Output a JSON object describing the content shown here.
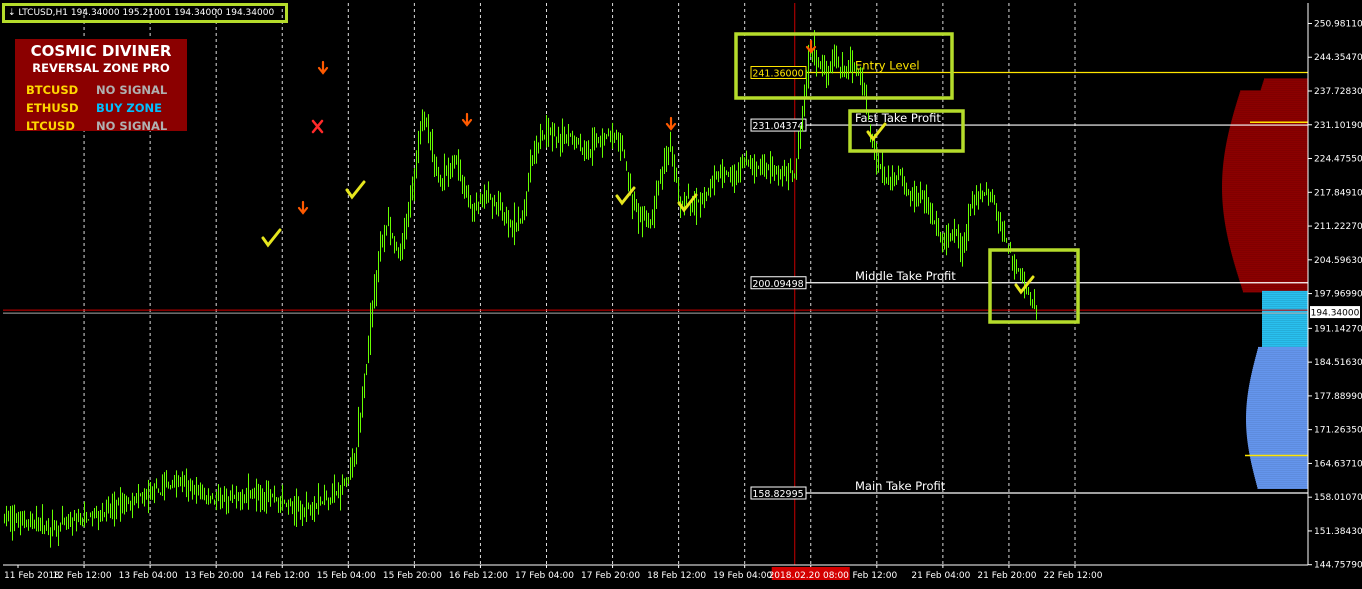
{
  "header": {
    "symbol_text": "LTCUSD,H1",
    "ohlc_text": "194.34000 195.21001 194.34000 194.34000"
  },
  "panel": {
    "title": "COSMIC DIVINER",
    "subtitle": "REVERSAL ZONE PRO",
    "rows": [
      {
        "symbol": "BTCUSD",
        "status": "NO SIGNAL",
        "color": "#b0b0b0"
      },
      {
        "symbol": "ETHUSD",
        "status": "BUY ZONE",
        "color": "#00bfff"
      },
      {
        "symbol": "LTCUSD",
        "status": "NO SIGNAL",
        "color": "#b0b0b0"
      }
    ]
  },
  "colors": {
    "candle": "#66ff00",
    "frame": "#b5dc2b",
    "check": "#e6e61e",
    "arrow": "#ff5a00",
    "cross": "#ff2a2a",
    "sell_zone": "#8b0000",
    "mid_zone": "#29c0ef",
    "buy_zone": "#6495ed",
    "yellow_line": "#ffe500"
  },
  "chart_data": {
    "type": "candlestick",
    "ylim": [
      144.7,
      255.0
    ],
    "y_ticks": [
      "250.98110",
      "244.35470",
      "237.72830",
      "231.10190",
      "224.47550",
      "217.84910",
      "211.22270",
      "204.59630",
      "197.96990",
      "191.14270",
      "184.51630",
      "177.88990",
      "171.26350",
      "164.63710",
      "158.01070",
      "151.38430",
      "144.75790"
    ],
    "y_tick_values": [
      250.9811,
      244.3547,
      237.7283,
      231.1019,
      224.4755,
      217.8491,
      211.2227,
      204.5963,
      197.9699,
      191.1427,
      184.5163,
      177.8899,
      171.2635,
      164.6371,
      158.0107,
      151.3843,
      144.7579
    ],
    "x_ticks": [
      "11 Feb 2018",
      "12 Feb 12:00",
      "13 Feb 04:00",
      "13 Feb 20:00",
      "14 Feb 12:00",
      "15 Feb 04:00",
      "15 Feb 20:00",
      "16 Feb 12:00",
      "17 Feb 04:00",
      "17 Feb 20:00",
      "18 Feb 12:00",
      "19 Feb 04:00",
      "2018.02.20 08:00",
      "Feb 12:00",
      "21 Feb 04:00",
      "21 Feb 20:00",
      "22 Feb 12:00"
    ],
    "current_price": "194.34000",
    "current_price_value": 194.34,
    "current_time_label": "2018.02.20 08:00",
    "levels": [
      {
        "name": "Entry Level",
        "value": 241.36,
        "label": "241.36000",
        "color": "#ffe500"
      },
      {
        "name": "Fast Take Profit",
        "value": 231.04374,
        "label": "231.04374",
        "color": "#ffffff"
      },
      {
        "name": "Middle Take Profit",
        "value": 200.09498,
        "label": "200.09498",
        "color": "#ffffff"
      },
      {
        "name": "Main Take Profit",
        "value": 158.82995,
        "label": "158.82995",
        "color": "#ffffff"
      }
    ],
    "price_path": [
      [
        0,
        154
      ],
      [
        2,
        152
      ],
      [
        4,
        155
      ],
      [
        5,
        157
      ],
      [
        6,
        159
      ],
      [
        7,
        161
      ],
      [
        8,
        158.5
      ],
      [
        9,
        157
      ],
      [
        10,
        159
      ],
      [
        11,
        158
      ],
      [
        12,
        155
      ],
      [
        13,
        158
      ],
      [
        13.5,
        159
      ],
      [
        14,
        163
      ],
      [
        14.3,
        170
      ],
      [
        14.6,
        182
      ],
      [
        14.9,
        196
      ],
      [
        15.2,
        207
      ],
      [
        15.5,
        212
      ],
      [
        15.7,
        208
      ],
      [
        16,
        205
      ],
      [
        16.2,
        210
      ],
      [
        16.4,
        216
      ],
      [
        16.6,
        222
      ],
      [
        16.8,
        230
      ],
      [
        17,
        232
      ],
      [
        17.3,
        226
      ],
      [
        17.6,
        220
      ],
      [
        18,
        222
      ],
      [
        18.3,
        225
      ],
      [
        18.6,
        218
      ],
      [
        19,
        214
      ],
      [
        19.5,
        217
      ],
      [
        20,
        215
      ],
      [
        20.5,
        211
      ],
      [
        21,
        213
      ],
      [
        21.3,
        224
      ],
      [
        21.6,
        228
      ],
      [
        22,
        230
      ],
      [
        22.5,
        228
      ],
      [
        23,
        229
      ],
      [
        23.5,
        226
      ],
      [
        24,
        228
      ],
      [
        24.5,
        229
      ],
      [
        25,
        227
      ],
      [
        25.4,
        216
      ],
      [
        25.8,
        213
      ],
      [
        26.2,
        212
      ],
      [
        26.6,
        222
      ],
      [
        27,
        226
      ],
      [
        27.3,
        216
      ],
      [
        27.6,
        216
      ],
      [
        28,
        215
      ],
      [
        28.5,
        218
      ],
      [
        29,
        222
      ],
      [
        29.5,
        221
      ],
      [
        30,
        224
      ],
      [
        30.5,
        222
      ],
      [
        31,
        223
      ],
      [
        31.5,
        221
      ],
      [
        32,
        222
      ],
      [
        32.3,
        233
      ],
      [
        32.6,
        246
      ],
      [
        32.9,
        244
      ],
      [
        33.2,
        242
      ],
      [
        33.6,
        244
      ],
      [
        34,
        241
      ],
      [
        34.4,
        243
      ],
      [
        34.8,
        238
      ],
      [
        35.1,
        228
      ],
      [
        35.4,
        223
      ],
      [
        35.8,
        220
      ],
      [
        36.2,
        222
      ],
      [
        36.6,
        217
      ],
      [
        37,
        218
      ],
      [
        37.5,
        214
      ],
      [
        38,
        207
      ],
      [
        38.4,
        210
      ],
      [
        38.8,
        207
      ],
      [
        39.2,
        216
      ],
      [
        39.6,
        218
      ],
      [
        40,
        217
      ],
      [
        40.3,
        212
      ],
      [
        40.6,
        207
      ],
      [
        41,
        203
      ],
      [
        41.3,
        200
      ],
      [
        41.6,
        196
      ],
      [
        41.8,
        194.34
      ]
    ],
    "x_domain": [
      0,
      44
    ]
  }
}
